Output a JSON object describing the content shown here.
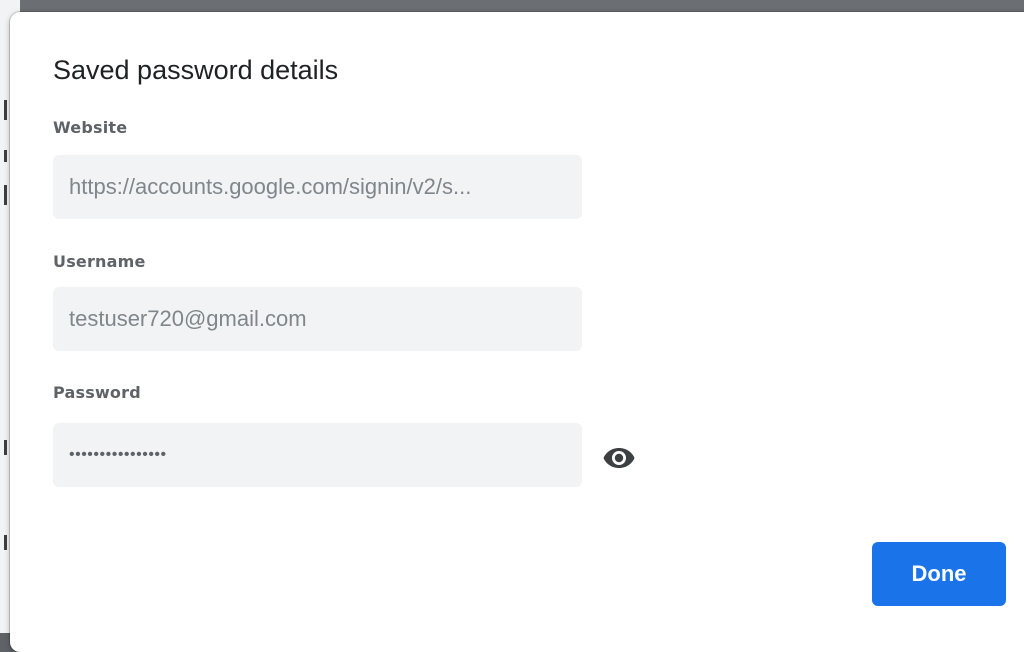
{
  "dialog": {
    "title": "Saved password details",
    "fields": [
      {
        "label": "Website",
        "value": "https://accounts.google.com/signin/v2/s..."
      },
      {
        "label": "Username",
        "value": "testuser720@gmail.com"
      },
      {
        "label": "Password",
        "value": "••••••••••••••••"
      }
    ],
    "show_password_icon": "eye-icon",
    "done_label": "Done"
  },
  "colors": {
    "accent": "#1a73e8",
    "field_bg": "#f1f3f4",
    "text_muted": "#80868b"
  }
}
